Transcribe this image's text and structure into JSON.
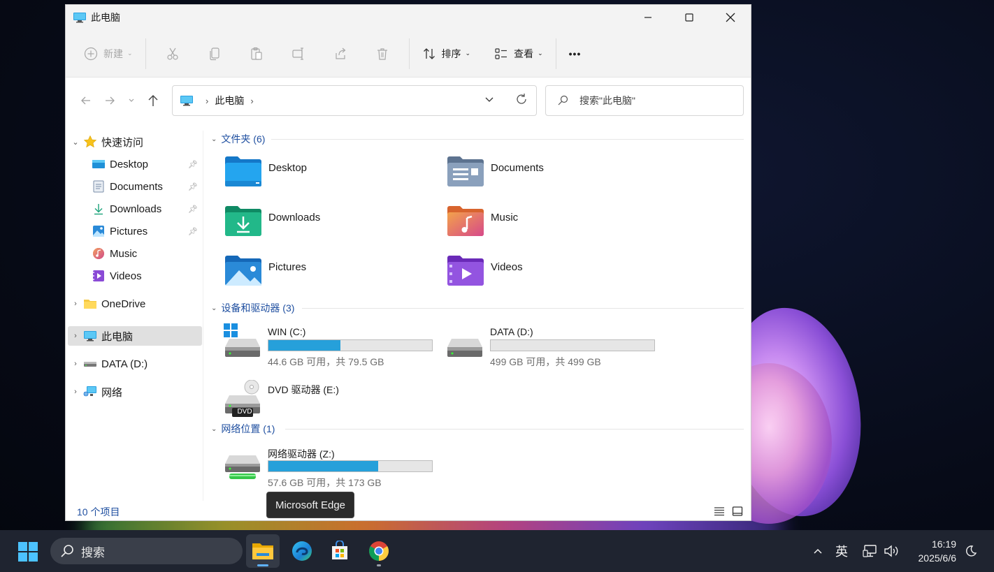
{
  "window": {
    "title": "此电脑",
    "controls": {
      "minimize": "minimize-icon",
      "maximize": "maximize-icon",
      "close": "close-icon"
    }
  },
  "toolbar": {
    "new_label": "新建",
    "sort_label": "排序",
    "view_label": "查看",
    "more_label": "•••"
  },
  "address": {
    "crumbs": [
      "此电脑"
    ],
    "search_placeholder": "搜索\"此电脑\""
  },
  "sidebar": {
    "quick_access": "快速访问",
    "pinned": [
      {
        "label": "Desktop",
        "icon": "desktop-folder-icon"
      },
      {
        "label": "Documents",
        "icon": "documents-folder-icon"
      },
      {
        "label": "Downloads",
        "icon": "downloads-folder-icon"
      },
      {
        "label": "Pictures",
        "icon": "pictures-folder-icon"
      },
      {
        "label": "Music",
        "icon": "music-folder-icon"
      },
      {
        "label": "Videos",
        "icon": "videos-folder-icon"
      }
    ],
    "onedrive": "OneDrive",
    "this_pc": "此电脑",
    "data_drive": "DATA (D:)",
    "network": "网络"
  },
  "content": {
    "folders_header": "文件夹 (6)",
    "folders": [
      {
        "label": "Desktop",
        "icon": "desktop-folder-icon",
        "color": "#1e90d8"
      },
      {
        "label": "Documents",
        "icon": "documents-folder-icon",
        "color": "#7a8ea8"
      },
      {
        "label": "Downloads",
        "icon": "downloads-folder-icon",
        "color": "#1aa37a"
      },
      {
        "label": "Music",
        "icon": "music-folder-icon",
        "color": "#e8734a"
      },
      {
        "label": "Pictures",
        "icon": "pictures-folder-icon",
        "color": "#2a8ad8"
      },
      {
        "label": "Videos",
        "icon": "videos-folder-icon",
        "color": "#8a4ad6"
      }
    ],
    "devices_header": "设备和驱动器 (3)",
    "drives": [
      {
        "label": "WIN (C:)",
        "detail": "44.6 GB 可用，共 79.5 GB",
        "used_fraction": 0.44
      },
      {
        "label": "DATA (D:)",
        "detail": "499 GB 可用，共 499 GB",
        "used_fraction": 0.0
      },
      {
        "label": "DVD 驱动器 (E:)",
        "badge": "DVD"
      }
    ],
    "network_header": "网络位置 (1)",
    "network_drives": [
      {
        "label": "网络驱动器 (Z:)",
        "detail": "57.6 GB 可用，共 173 GB",
        "used_fraction": 0.67
      }
    ]
  },
  "status": {
    "item_count": "10 个项目"
  },
  "tooltip": "Microsoft Edge",
  "taskbar": {
    "search_label": "搜索",
    "apps": [
      "file-explorer-icon",
      "edge-icon",
      "store-icon",
      "chrome-icon"
    ],
    "ime": "英",
    "time": "16:19",
    "date": "2025/6/6"
  },
  "colors": {
    "accent": "#26a0da",
    "group_header": "#1f4fa0",
    "taskbar": "#1f2430"
  }
}
